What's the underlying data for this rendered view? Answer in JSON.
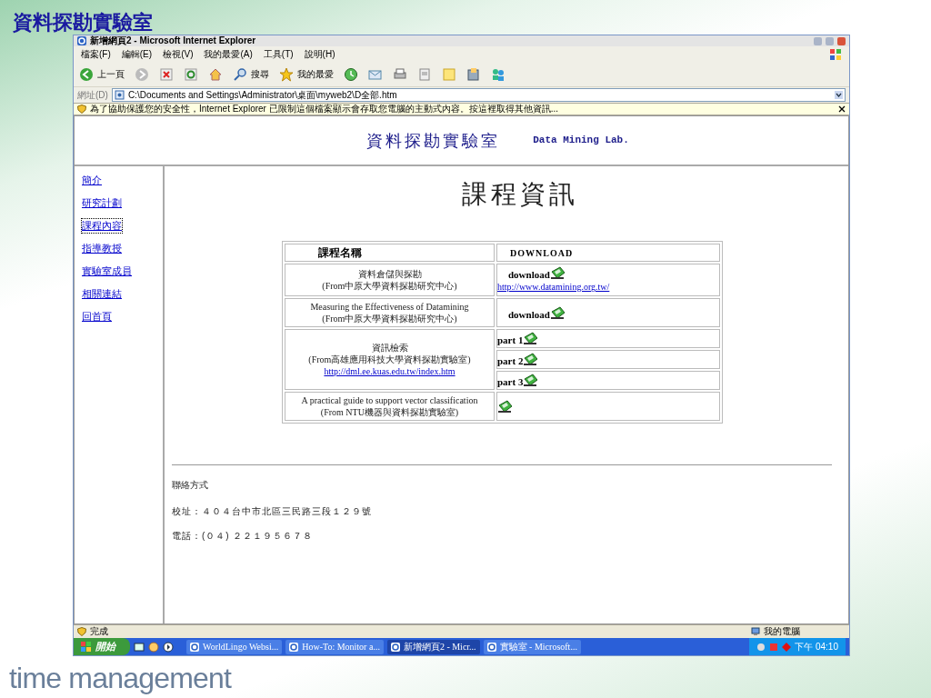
{
  "slide": {
    "title": "資料探勘實驗室",
    "footer": "time management"
  },
  "window": {
    "title": "新增網頁2 - Microsoft Internet Explorer"
  },
  "menu": [
    "檔案(F)",
    "編輯(E)",
    "檢視(V)",
    "我的最愛(A)",
    "工具(T)",
    "說明(H)"
  ],
  "toolbar": [
    {
      "kind": "back",
      "label": "上一頁"
    },
    {
      "kind": "forward"
    },
    {
      "kind": "stop"
    },
    {
      "kind": "refresh"
    },
    {
      "kind": "home"
    },
    {
      "kind": "search",
      "label": "搜尋"
    },
    {
      "kind": "favorites",
      "label": "我的最愛"
    },
    {
      "kind": "history"
    },
    {
      "kind": "mail"
    },
    {
      "kind": "print"
    },
    {
      "kind": "edit"
    },
    {
      "kind": "note"
    },
    {
      "kind": "folder"
    },
    {
      "kind": "people"
    }
  ],
  "address": {
    "label": "網址(D)",
    "value": "C:\\Documents and Settings\\Administrator\\桌面\\myweb2\\D全部.htm"
  },
  "info_bar": "為了協助保護您的安全性，Internet Explorer 已限制這個檔案顯示會存取您電腦的主動式內容。按這裡取得其他資訊...",
  "page": {
    "header": {
      "title": "資料探勘實驗室",
      "subtitle": "Data Mining Lab."
    },
    "nav": [
      {
        "label": "簡介",
        "selected": false
      },
      {
        "label": "研究計劃",
        "selected": false
      },
      {
        "label": "課程內容",
        "selected": true
      },
      {
        "label": "指導教授",
        "selected": false
      },
      {
        "label": "實驗室成員",
        "selected": false
      },
      {
        "label": "相關連結",
        "selected": false
      },
      {
        "label": "回首頁",
        "selected": false
      }
    ],
    "heading": "課程資訊",
    "table": {
      "columns": [
        "課程名稱",
        "DOWNLOAD"
      ],
      "rows": [
        {
          "lines": [
            "資料倉儲與探勘",
            "(From中原大學資料探勘研究中心)"
          ],
          "downloads": [
            {
              "label": "download",
              "link": "http://www.datamining.org.tw/"
            }
          ]
        },
        {
          "lines": [
            "Measuring the Effectiveness of Datamining",
            "(From中原大學資料探勘研究中心)"
          ],
          "downloads": [
            {
              "label": "download"
            }
          ]
        },
        {
          "lines": [
            "資訊檢索",
            "(From高雄應用科技大學資料探勘實驗室)"
          ],
          "link": "http://dml.ee.kuas.edu.tw/index.htm",
          "downloads": [
            {
              "label": "part 1"
            },
            {
              "label": "part 2"
            },
            {
              "label": "part 3"
            }
          ]
        },
        {
          "lines": [
            "A practical guide to support vector classification",
            "(From NTU機器與資料探勘實驗室)"
          ],
          "downloads": [
            {
              "kind": "icon"
            }
          ]
        }
      ]
    },
    "contact": [
      "聯絡方式",
      "校址：４０４台中市北區三民路三段１２９號",
      "電話：(０４) ２２１９５６７８"
    ]
  },
  "status_bar": {
    "text": "完成",
    "zone": "我的電腦"
  },
  "taskbar": {
    "start": "開始",
    "tasks": [
      {
        "label": "WorldLingo Websi...",
        "selected": false
      },
      {
        "label": "How-To: Monitor a...",
        "selected": false
      },
      {
        "label": "新增網頁2 - Micr...",
        "selected": true
      },
      {
        "label": "實驗室 - Microsoft...",
        "selected": false
      }
    ],
    "clock": "下午 04:10"
  }
}
